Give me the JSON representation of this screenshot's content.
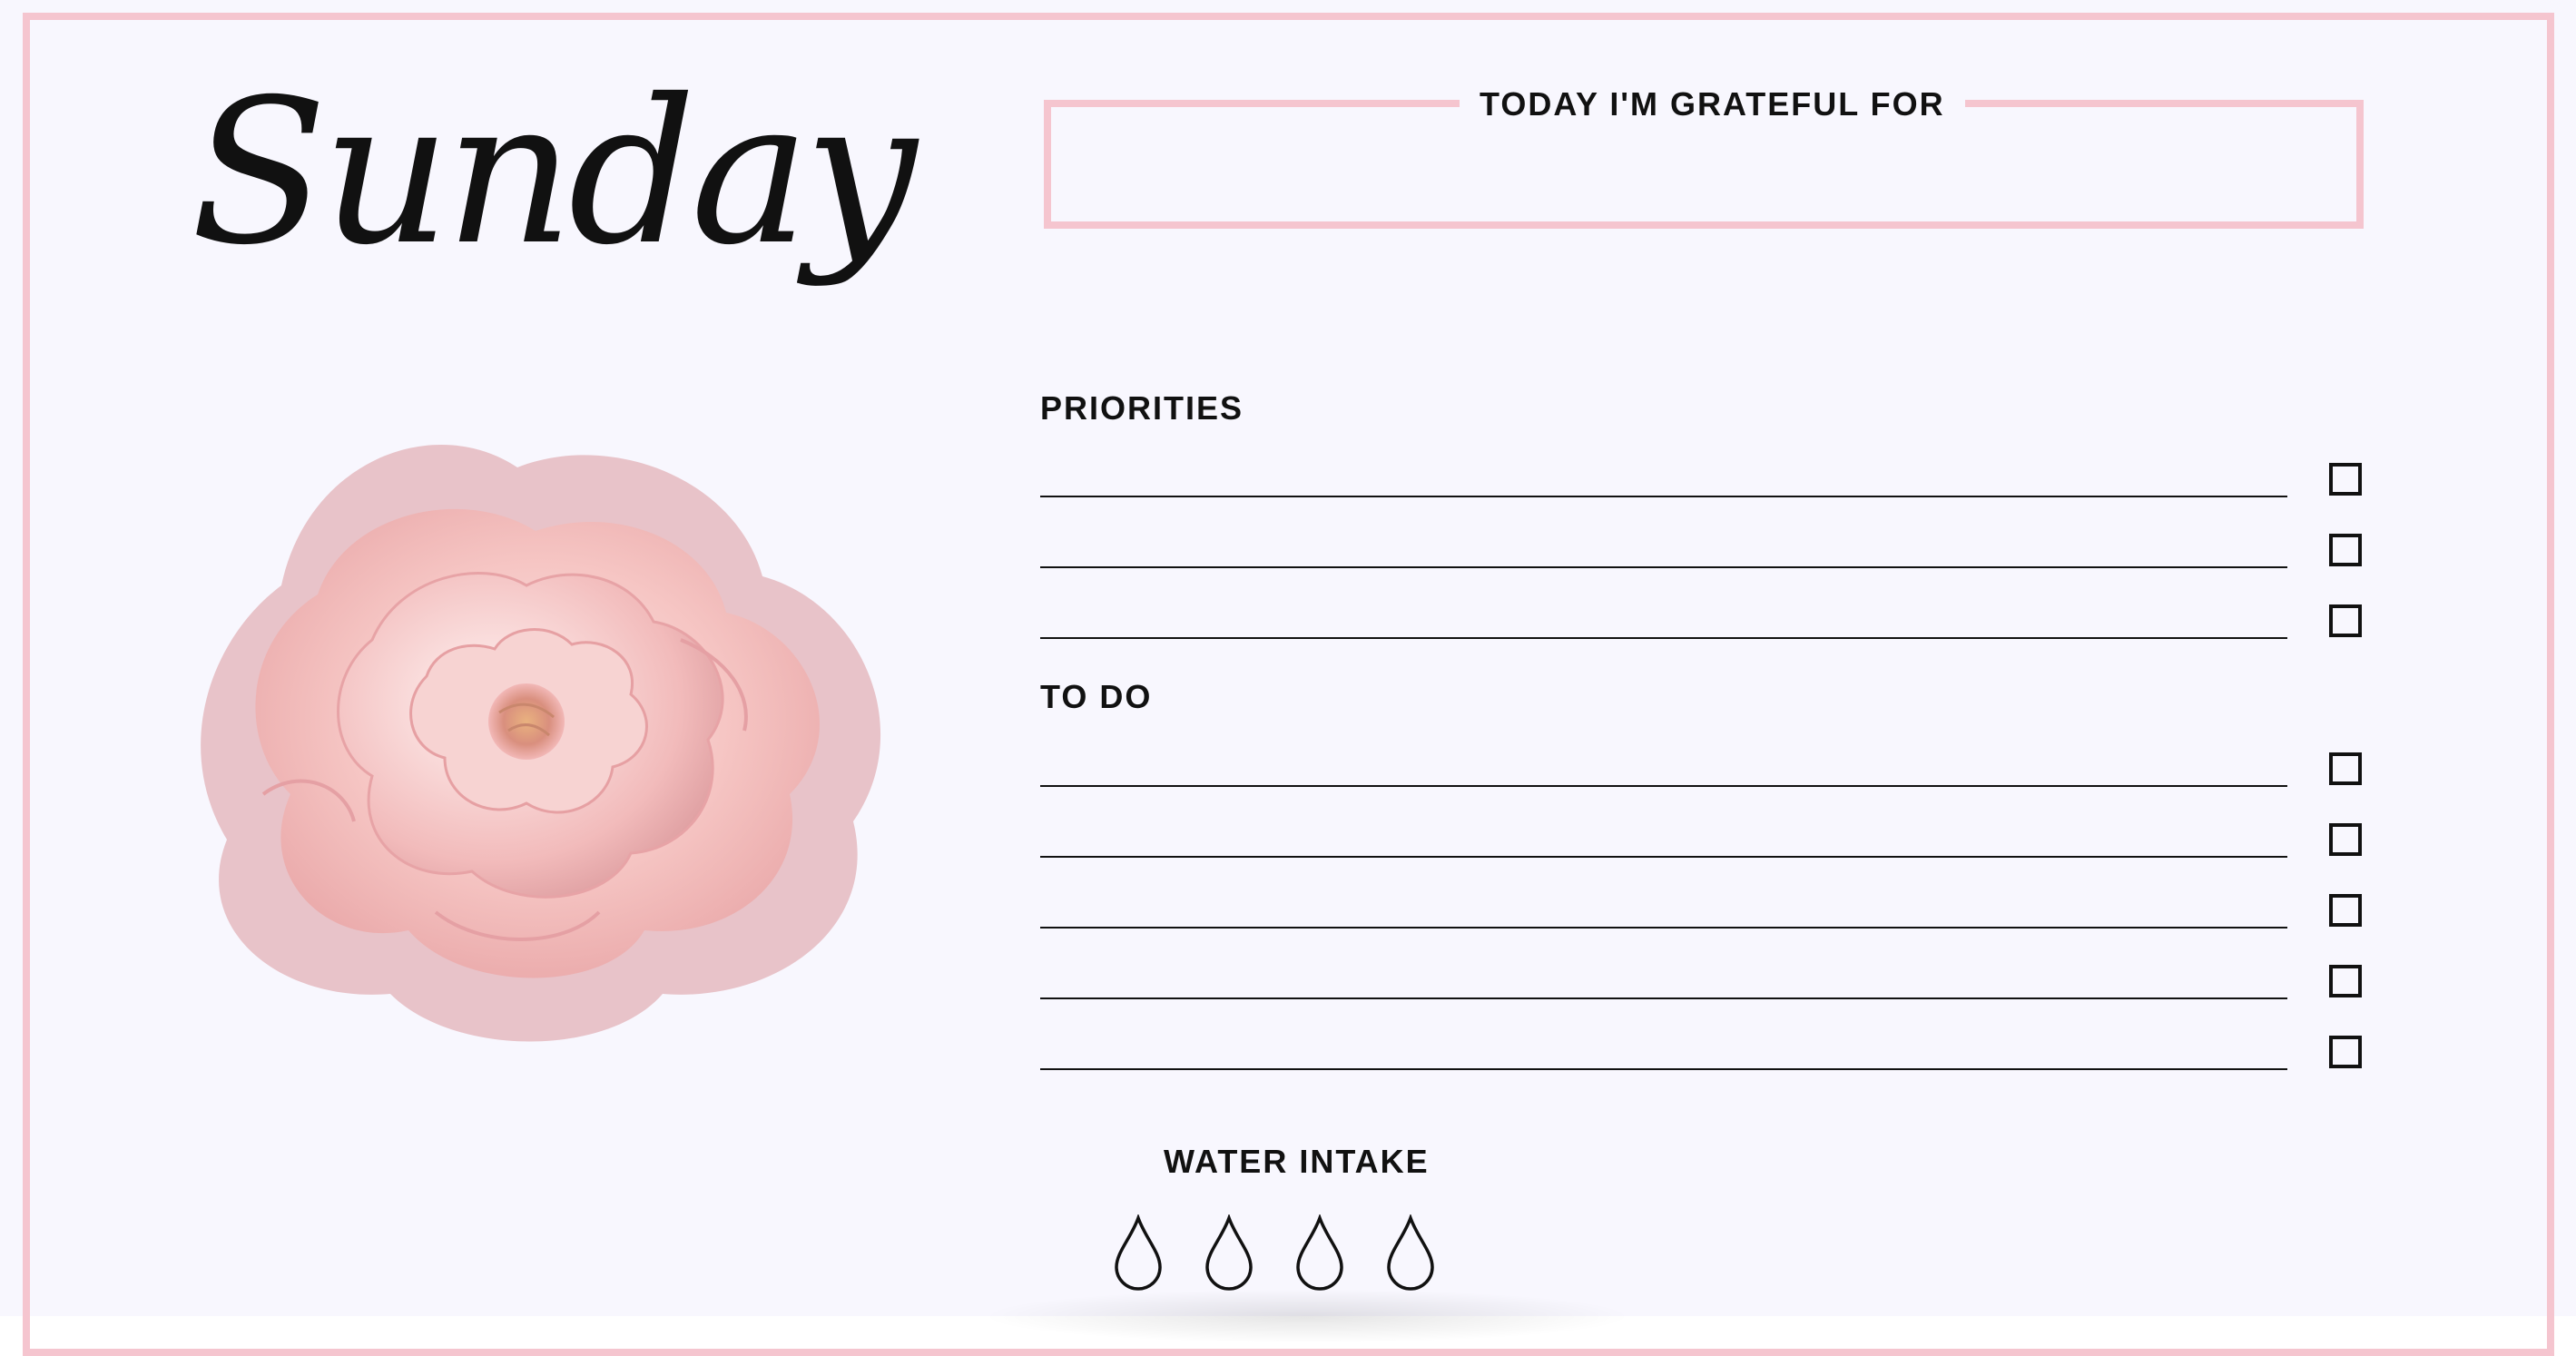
{
  "planner": {
    "day": "Sunday",
    "grateful_label": "TODAY I'M GRATEFUL FOR",
    "priorities_label": "PRIORITIES",
    "todo_label": "TO DO",
    "water_label": "WATER INTAKE"
  },
  "colors": {
    "frame_pink": "#f5c5cf",
    "background": "#f8f7fe",
    "ink": "#111111"
  },
  "icons": {
    "flower": "rose-flower-icon",
    "checkbox": "checkbox-icon",
    "water": "water-drop-icon"
  }
}
